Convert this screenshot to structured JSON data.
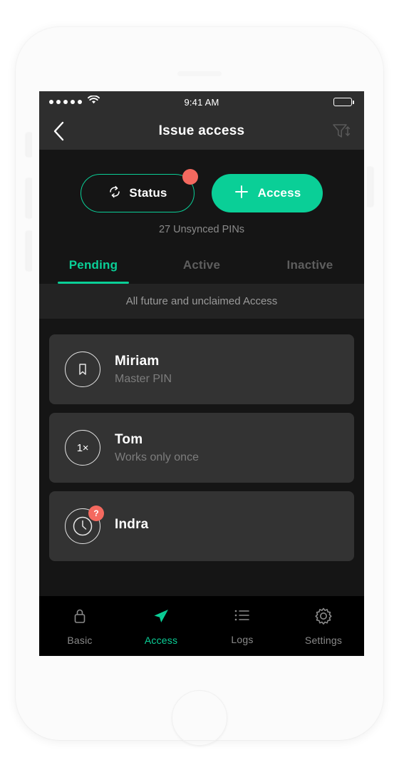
{
  "status_bar": {
    "signal_dots": 5,
    "wifi_icon": "wifi-icon",
    "time": "9:41 AM",
    "battery_icon": "battery-full-icon"
  },
  "header": {
    "back_icon": "chevron-left-icon",
    "title": "Issue access",
    "filter_icon": "filter-sort-icon"
  },
  "actions": {
    "status": {
      "label": "Status",
      "icon": "sync-icon",
      "badge": true,
      "badge_color": "#F4695F",
      "border_color": "#0ACF97"
    },
    "access": {
      "label": "Access",
      "icon": "plus-icon",
      "background": "#0ACF97"
    },
    "unsynced_text": "27 Unsynced PINs"
  },
  "tabs": [
    {
      "label": "Pending",
      "active": true
    },
    {
      "label": "Active",
      "active": false
    },
    {
      "label": "Inactive",
      "active": false
    }
  ],
  "section_banner": "All future and unclaimed Access",
  "list": [
    {
      "icon": "bookmark-icon",
      "icon_text": "",
      "title": "Miriam",
      "subtitle": "Master PIN",
      "badge": ""
    },
    {
      "icon": "once-icon",
      "icon_text": "1×",
      "title": "Tom",
      "subtitle": "Works only once",
      "badge": ""
    },
    {
      "icon": "clock-icon",
      "icon_text": "",
      "title": "Indra",
      "subtitle": "",
      "badge": "?"
    }
  ],
  "bottom_nav": [
    {
      "label": "Basic",
      "icon": "lock-icon",
      "active": false
    },
    {
      "label": "Access",
      "icon": "paper-plane-icon",
      "active": true
    },
    {
      "label": "Logs",
      "icon": "list-icon",
      "active": false
    },
    {
      "label": "Settings",
      "icon": "gear-icon",
      "active": false
    }
  ],
  "colors": {
    "accent": "#0ACF97",
    "badge": "#F4695F",
    "screen_bg": "#151515",
    "card_bg": "#333333",
    "header_bg": "#2E2E2E"
  }
}
